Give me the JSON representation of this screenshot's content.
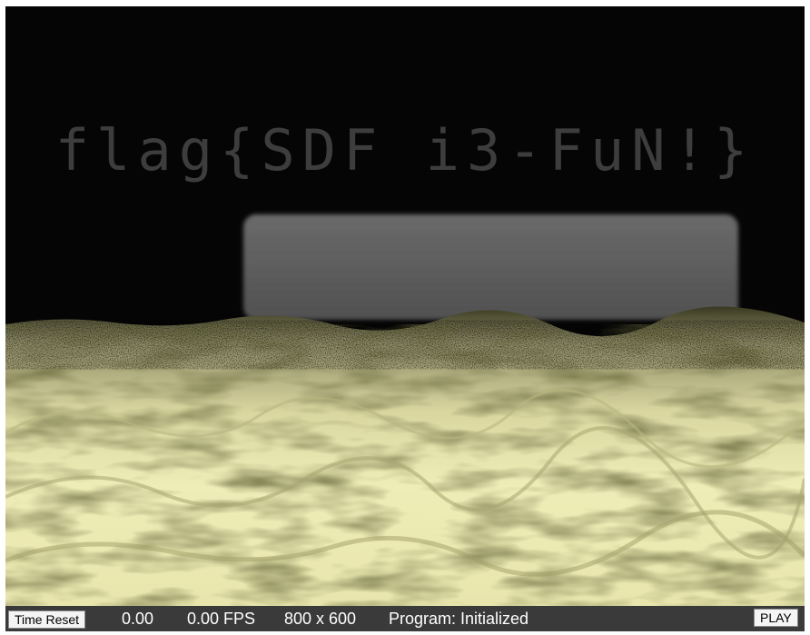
{
  "scene": {
    "flag_text": "flag{SDF i3-FuN!}",
    "colors": {
      "sky": "#050505",
      "flag_text": "#3c3c3c",
      "panel": "#5a5a5a",
      "terrain_light": "#f0eeb8",
      "terrain_dark": "#2a2a18"
    }
  },
  "status_bar": {
    "time_reset_label": "Time Reset",
    "time": "0.00",
    "fps": "0.00 FPS",
    "resolution": "800 x 600",
    "program_status": "Program: Initialized",
    "play_label": "PLAY"
  }
}
